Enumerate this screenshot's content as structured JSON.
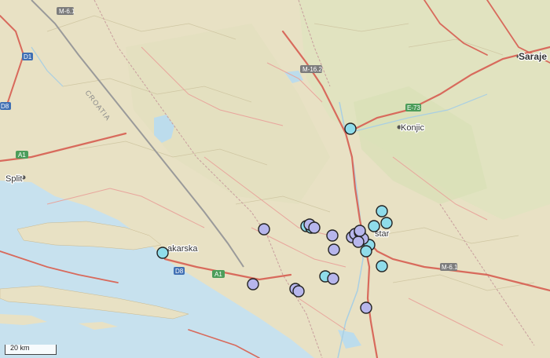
{
  "places": [
    {
      "name": "Sarajevo",
      "label": "Saraje",
      "big": true
    },
    {
      "name": "Konjic",
      "label": "Konjic",
      "big": false
    },
    {
      "name": "Split",
      "label": "Split",
      "big": false
    },
    {
      "name": "Makarska",
      "label": "akarska",
      "big": false
    },
    {
      "name": "Mostar",
      "label": "star",
      "big": false
    }
  ],
  "roads": [
    {
      "id": "m61-top",
      "label": "M-6.1"
    },
    {
      "id": "m162",
      "label": "M-16.2"
    },
    {
      "id": "e73",
      "label": "E-73"
    },
    {
      "id": "m61-east",
      "label": "M-6.1"
    },
    {
      "id": "a1-west",
      "label": "A1"
    },
    {
      "id": "a1-south",
      "label": "A1"
    },
    {
      "id": "d1",
      "label": "D1"
    },
    {
      "id": "d8-west",
      "label": "D8"
    },
    {
      "id": "d8-south",
      "label": "D8"
    }
  ],
  "country_label": "CROATIA",
  "scale_label": "20 km",
  "marker_colors": {
    "cyan": "#8fdcea",
    "lavender": "#b7b6ec"
  },
  "markers_count_visible": 34
}
